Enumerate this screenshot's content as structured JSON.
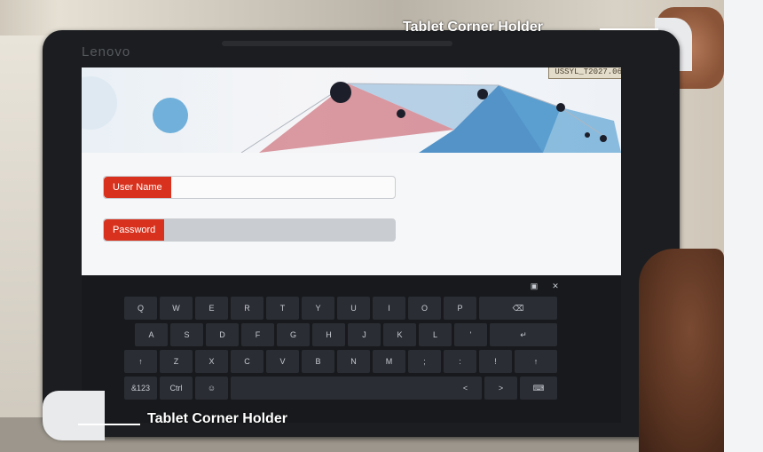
{
  "tablet": {
    "brand": "Lenovo",
    "version_tag": "USSYL_T2027.06",
    "login": {
      "username_label": "User Name",
      "username_value": "",
      "password_label": "Password",
      "password_value": ""
    },
    "keyboard": {
      "row1": [
        "Q",
        "W",
        "E",
        "R",
        "T",
        "Y",
        "U",
        "I",
        "O",
        "P"
      ],
      "row1_end": "⌫",
      "row2": [
        "A",
        "S",
        "D",
        "F",
        "G",
        "H",
        "J",
        "K",
        "L",
        "'"
      ],
      "row2_end": "↵",
      "row3_start": "↑",
      "row3": [
        "Z",
        "X",
        "C",
        "V",
        "B",
        "N",
        "M",
        ";",
        ":",
        "!"
      ],
      "row3_end": "↑",
      "row4": [
        "&123",
        "Ctrl",
        "☺"
      ],
      "row4_right": [
        "<",
        ">",
        "⌨"
      ],
      "top_right_icons": [
        "▣",
        "✕"
      ]
    }
  },
  "annotations": {
    "top_right": "Tablet Corner Holder",
    "bottom_left": "Tablet Corner Holder"
  },
  "colors": {
    "accent_red": "#d8321e",
    "tablet_body": "#1b1d20"
  }
}
